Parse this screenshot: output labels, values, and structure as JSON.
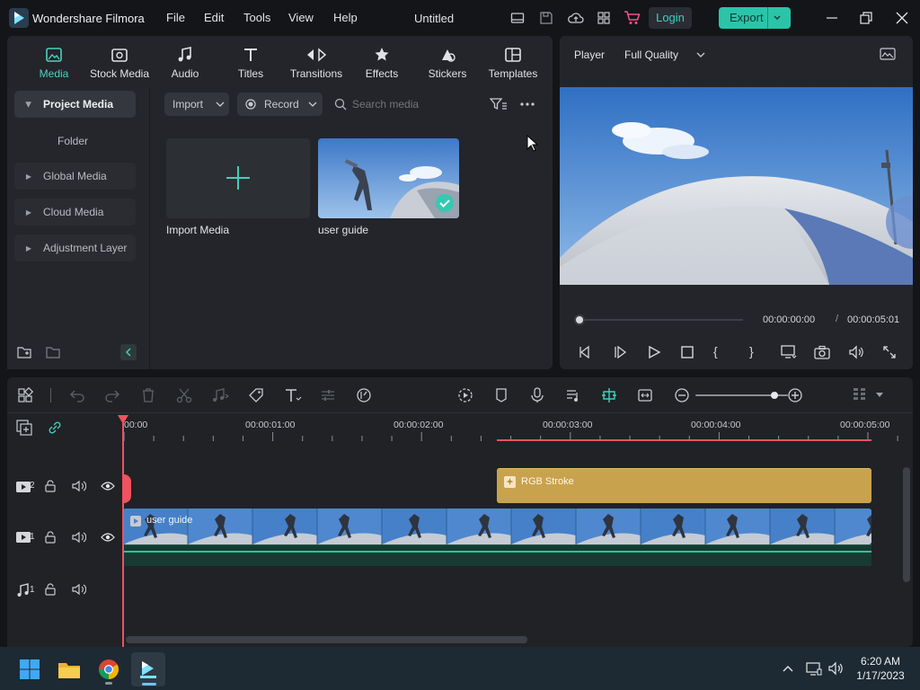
{
  "app": {
    "name": "Wondershare Filmora",
    "doc_title": "Untitled"
  },
  "menu": [
    "File",
    "Edit",
    "Tools",
    "View",
    "Help"
  ],
  "header": {
    "login": "Login",
    "export": "Export"
  },
  "tabs": [
    {
      "label": "Media",
      "icon": "media-icon",
      "active": true
    },
    {
      "label": "Stock Media",
      "icon": "stock-media-icon"
    },
    {
      "label": "Audio",
      "icon": "audio-icon"
    },
    {
      "label": "Titles",
      "icon": "titles-icon"
    },
    {
      "label": "Transitions",
      "icon": "transitions-icon"
    },
    {
      "label": "Effects",
      "icon": "effects-icon"
    },
    {
      "label": "Stickers",
      "icon": "stickers-icon"
    },
    {
      "label": "Templates",
      "icon": "templates-icon"
    }
  ],
  "sidebar": {
    "project_media": "Project Media",
    "folder": "Folder",
    "global_media": "Global Media",
    "cloud_media": "Cloud Media",
    "adjustment_layer": "Adjustment Layer"
  },
  "media_toolbar": {
    "import": "Import",
    "record": "Record",
    "search_placeholder": "Search media"
  },
  "media_items": [
    {
      "label": "Import Media"
    },
    {
      "label": "user guide"
    }
  ],
  "player": {
    "label": "Player",
    "quality": "Full Quality",
    "current_time": "00:00:00:00",
    "separator": "/",
    "total_time": "00:00:05:01",
    "progress": 0
  },
  "timeline": {
    "ruler": [
      "00:00",
      "00:00:01:00",
      "00:00:02:00",
      "00:00:03:00",
      "00:00:04:00",
      "00:00:05:00"
    ],
    "tracks": [
      {
        "number": "2",
        "type": "video"
      },
      {
        "number": "1",
        "type": "video"
      },
      {
        "number": "1",
        "type": "audio"
      }
    ],
    "effect_clip": "RGB Stroke",
    "video_clip": "user guide",
    "zoom_level": 0.85
  },
  "taskbar": {
    "time": "6:20 AM",
    "date": "1/17/2023"
  },
  "colors": {
    "accent": "#33c7b3",
    "export": "#2bc4a9",
    "effect_clip": "#c9a24e",
    "playhead": "#f0525f"
  }
}
